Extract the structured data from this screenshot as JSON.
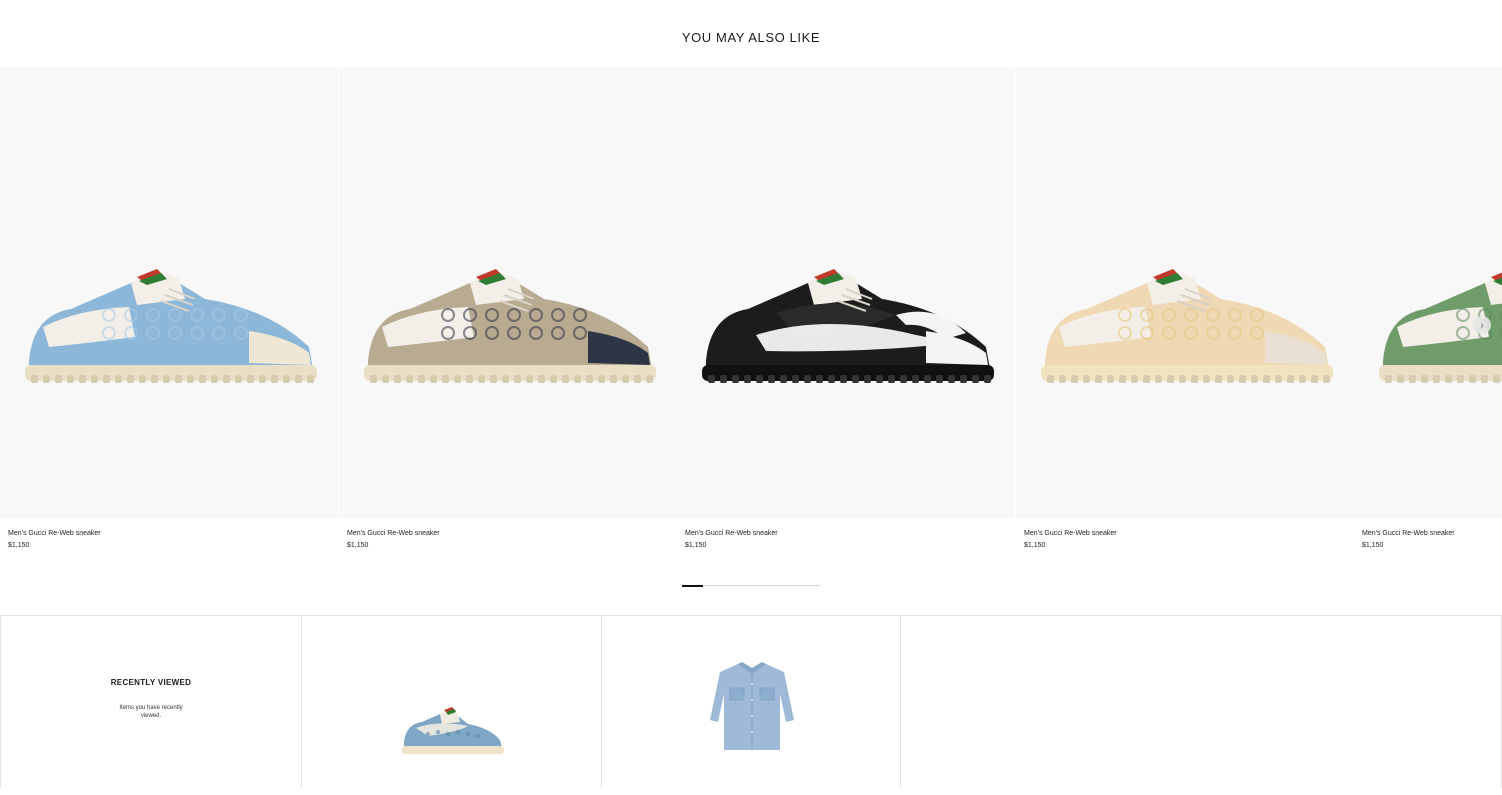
{
  "section": {
    "title": "YOU MAY ALSO LIKE"
  },
  "products": [
    {
      "name": "Men's Gucci Re-Web sneaker",
      "price": "$1,150",
      "colorway": "light-blue-gg",
      "upper": "#8db7d8",
      "panel": "#efe6d6",
      "sole": "#e9dfc7",
      "accent": "#a9c9e6"
    },
    {
      "name": "Men's Gucci Re-Web sneaker",
      "price": "$1,150",
      "colorway": "beige-navy-gg",
      "upper": "#b9ab91",
      "panel": "#2c3446",
      "sole": "#e9dfc7",
      "accent": "#2c3446"
    },
    {
      "name": "Men's Gucci Re-Web sneaker",
      "price": "$1,150",
      "colorway": "black-white",
      "upper": "#1c1c1c",
      "panel": "#f4f4f4",
      "sole": "#111111",
      "accent": "#f4f4f4"
    },
    {
      "name": "Men's Gucci Re-Web sneaker",
      "price": "$1,150",
      "colorway": "cream-gg",
      "upper": "#eed9b4",
      "panel": "#e9dfd2",
      "sole": "#f1e3bf",
      "accent": "#e8c680"
    },
    {
      "name": "Men's Gucci Re-Web sneaker",
      "price": "$1,150",
      "colorway": "green-gg",
      "upper": "#6f9c6a",
      "panel": "#efe6d6",
      "sole": "#e9dfc7",
      "accent": "#5e8a5a"
    }
  ],
  "carousel": {
    "next_icon": "chevron-right-icon",
    "progress": 0.15
  },
  "recently_viewed": {
    "title": "RECENTLY VIEWED",
    "subtitle": "Items you have recently viewed.",
    "items": [
      {
        "kind": "sneaker",
        "colorway": "blue-gg"
      },
      {
        "kind": "denim-shirt",
        "colorway": "light-blue"
      }
    ]
  }
}
